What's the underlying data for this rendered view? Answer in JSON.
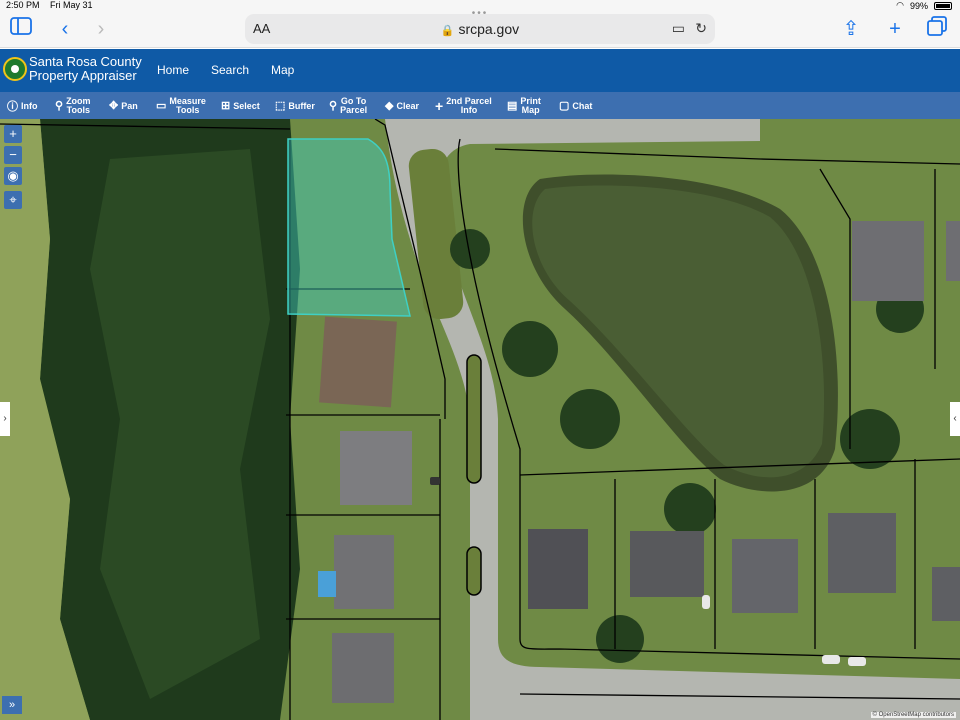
{
  "status": {
    "time": "2:50 PM",
    "date": "Fri May 31",
    "battery": "99%"
  },
  "browser": {
    "aa_label": "AA",
    "url": "srcpa.gov"
  },
  "header": {
    "brand_line1": "Santa Rosa County",
    "brand_line2": "Property Appraiser",
    "nav": [
      "Home",
      "Search",
      "Map"
    ]
  },
  "toolbar": {
    "info": "Info",
    "zoom_tools_1": "Zoom",
    "zoom_tools_2": "Tools",
    "pan": "Pan",
    "measure_tools_1": "Measure",
    "measure_tools_2": "Tools",
    "select": "Select",
    "buffer": "Buffer",
    "goto_1": "Go To",
    "goto_2": "Parcel",
    "clear": "Clear",
    "second_parcel_1": "2nd Parcel",
    "second_parcel_2": "Info",
    "print_1": "Print",
    "print_2": "Map",
    "chat": "Chat"
  },
  "map": {
    "zoom_in": "+",
    "zoom_out": "−",
    "expand": "»",
    "attribution": "© OpenStreetMap contributors",
    "selected_parcel_color": "#3fd0c4"
  },
  "colors": {
    "header": "#0f5aa6",
    "toolbar": "#3d6fb0",
    "accent": "#1a73e8"
  }
}
